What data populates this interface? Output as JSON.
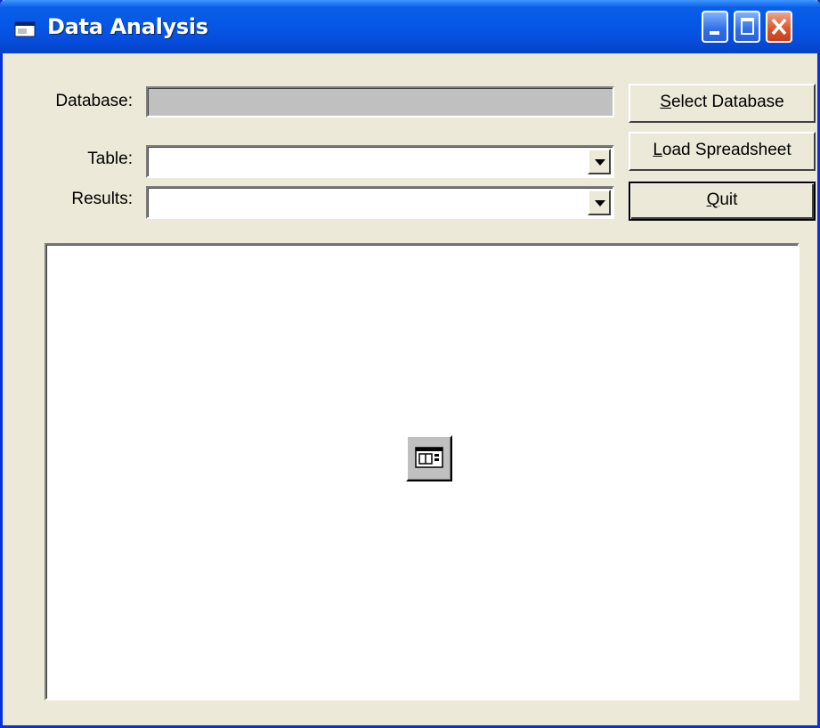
{
  "window": {
    "title": "Data Analysis",
    "title_icon": "form-window-icon",
    "controls": {
      "minimize": "minimize-icon",
      "maximize": "maximize-icon",
      "close": "close-icon"
    },
    "colors": {
      "titlebar": "#0559e6",
      "face": "#ece9d8",
      "close_button": "#d9542b"
    }
  },
  "form": {
    "database_label": "Database:",
    "database_value": "",
    "table_label": "Table:",
    "table_value": "",
    "results_label": "Results:",
    "results_value": ""
  },
  "buttons": {
    "select_database": {
      "access_key": "S",
      "rest": "elect Database"
    },
    "load_spreadsheet": {
      "access_key": "L",
      "rest": "oad Spreadsheet"
    },
    "quit": {
      "access_key": "Q",
      "rest": "uit"
    }
  },
  "panel": {
    "placeholder_icon": "ole-control-icon"
  }
}
